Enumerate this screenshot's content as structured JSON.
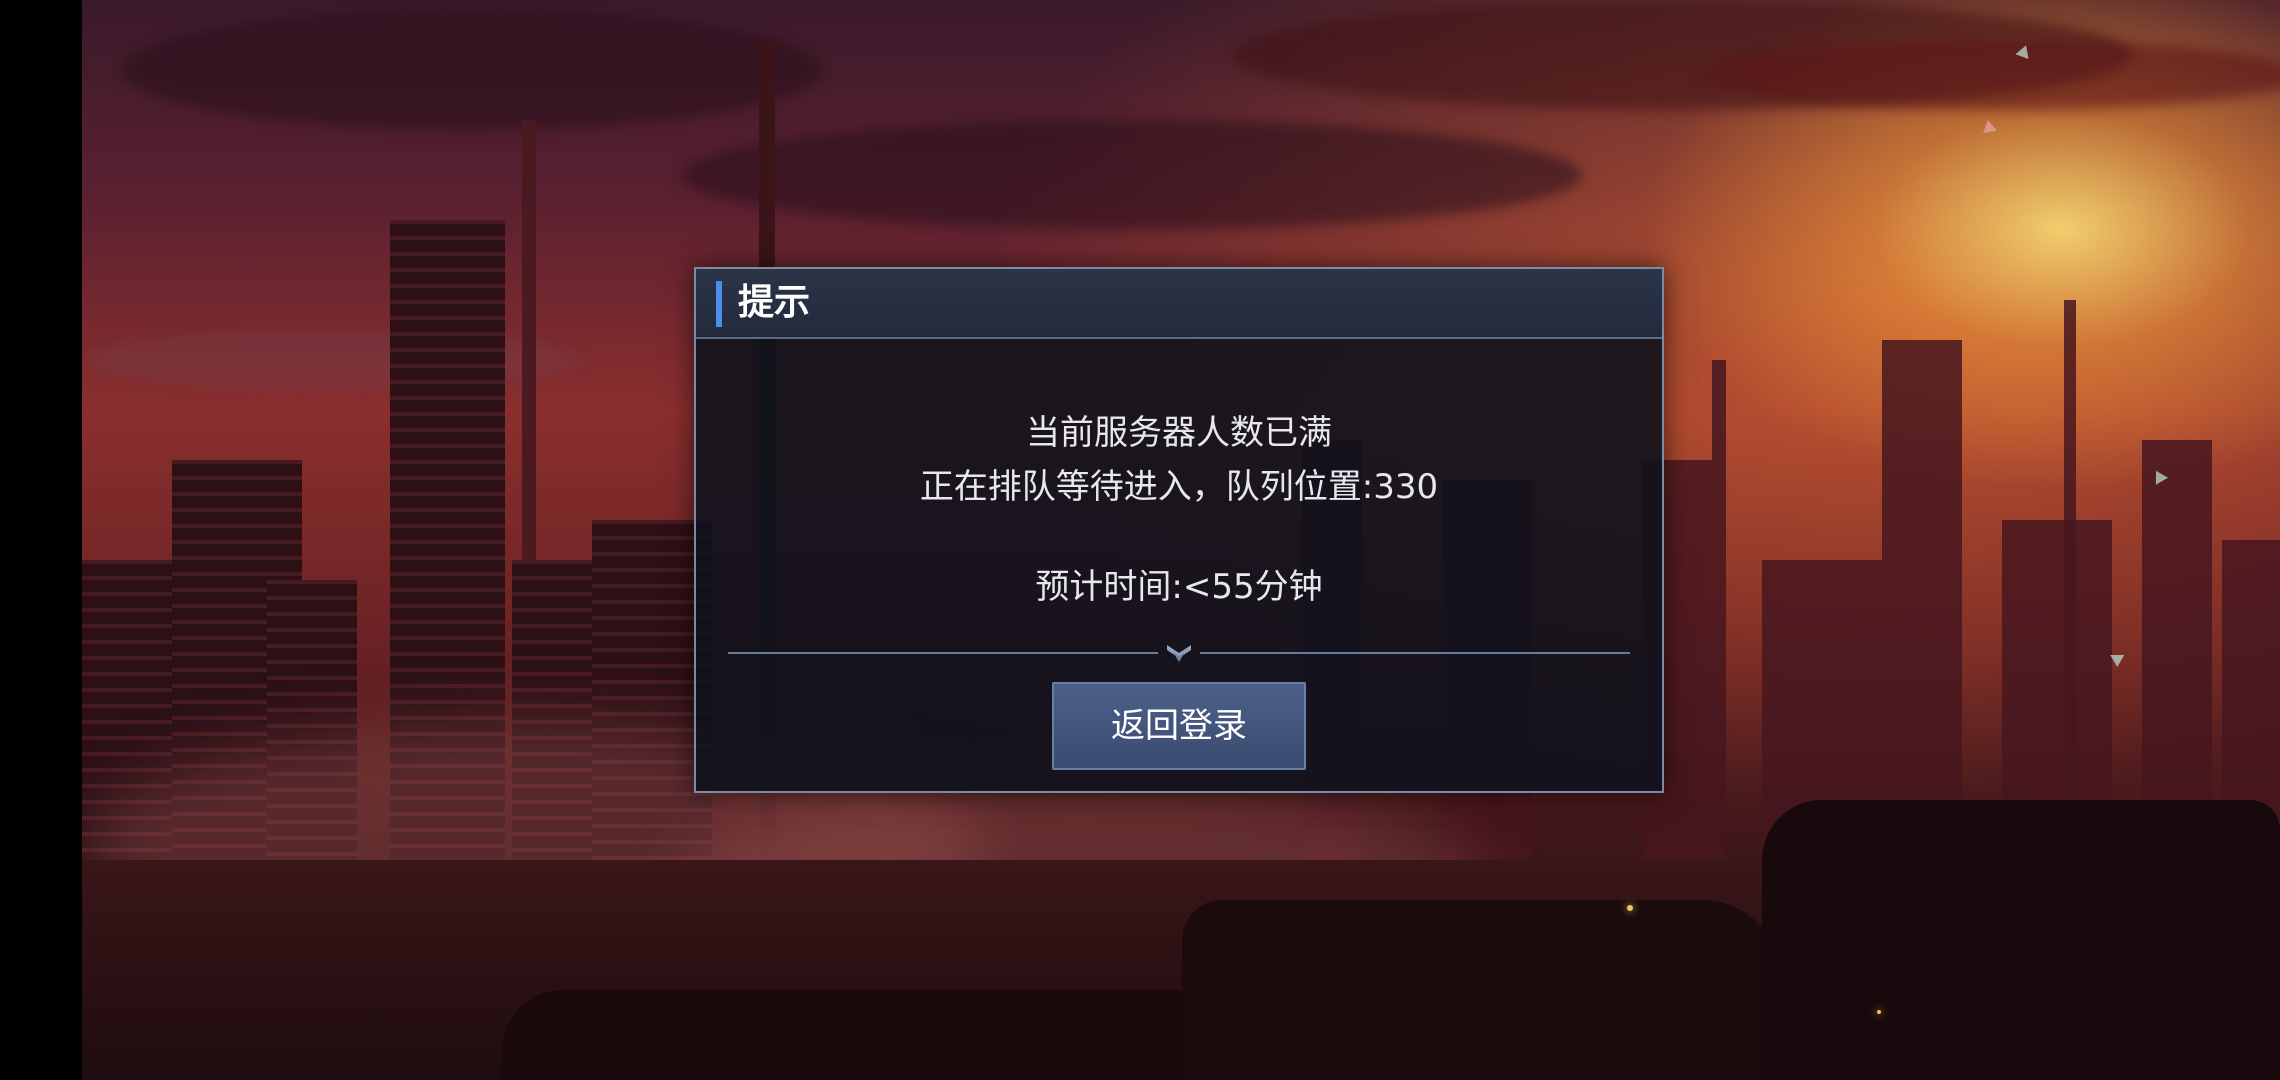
{
  "dialog": {
    "title": "提示",
    "message_line1": "当前服务器人数已满",
    "message_line2": "正在排队等待进入，队列位置:330",
    "message_line3": "预计时间:<55分钟",
    "divider_icon": "chevron-down-diamond-icon",
    "back_button_label": "返回登录"
  },
  "colors": {
    "title_accent": "#4a8ff0",
    "button_fill": "#44567d",
    "dialog_border": "#7d8aa3",
    "sky_glow": "#f0a040"
  }
}
